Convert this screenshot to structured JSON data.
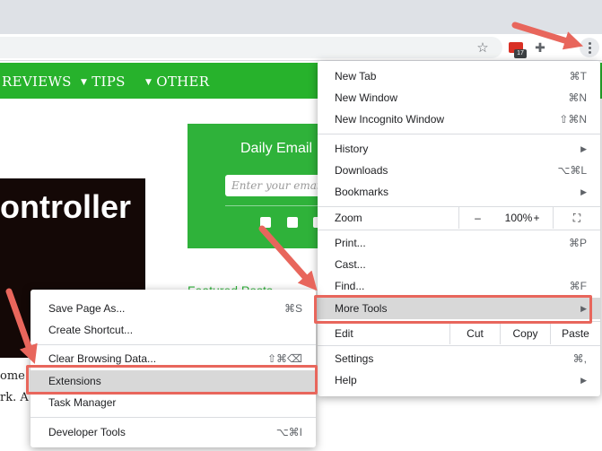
{
  "toolbar": {
    "star_icon": "bookmark-star-icon",
    "extension_badge": "17",
    "puzzle_icon": "extensions-puzzle-icon",
    "menu_icon": "kebab-menu-icon"
  },
  "site_nav": {
    "items": [
      {
        "label": "REVIEWS",
        "caret": false
      },
      {
        "label": "TIPS",
        "caret": true
      },
      {
        "label": "OTHER",
        "caret": true
      }
    ]
  },
  "page": {
    "hero_text": "ontroller",
    "email_title": "Daily Email",
    "email_placeholder": "Enter your email",
    "featured_heading": "Featured Posts",
    "body_line_1": "ome",
    "body_line_2": "rk. A"
  },
  "chrome_menu": {
    "new_tab": {
      "label": "New Tab",
      "shortcut": "⌘T"
    },
    "new_window": {
      "label": "New Window",
      "shortcut": "⌘N"
    },
    "new_incognito": {
      "label": "New Incognito Window",
      "shortcut": "⇧⌘N"
    },
    "history": {
      "label": "History"
    },
    "downloads": {
      "label": "Downloads",
      "shortcut": "⌥⌘L"
    },
    "bookmarks": {
      "label": "Bookmarks"
    },
    "zoom": {
      "label": "Zoom",
      "minus": "–",
      "value": "100%",
      "plus": "+"
    },
    "print": {
      "label": "Print...",
      "shortcut": "⌘P"
    },
    "cast": {
      "label": "Cast..."
    },
    "find": {
      "label": "Find...",
      "shortcut": "⌘F"
    },
    "more_tools": {
      "label": "More Tools"
    },
    "edit": {
      "label": "Edit",
      "cut": "Cut",
      "copy": "Copy",
      "paste": "Paste"
    },
    "settings": {
      "label": "Settings",
      "shortcut": "⌘,"
    },
    "help": {
      "label": "Help"
    }
  },
  "more_tools_menu": {
    "save_page": {
      "label": "Save Page As...",
      "shortcut": "⌘S"
    },
    "create_shortcut": {
      "label": "Create Shortcut..."
    },
    "clear_data": {
      "label": "Clear Browsing Data...",
      "shortcut": "⇧⌘⌫"
    },
    "extensions": {
      "label": "Extensions"
    },
    "task_manager": {
      "label": "Task Manager"
    },
    "dev_tools": {
      "label": "Developer Tools",
      "shortcut": "⌥⌘I"
    }
  },
  "colors": {
    "site_green": "#27b22c",
    "highlight_red": "#e8665c",
    "menu_hover": "#d8d8d8"
  }
}
